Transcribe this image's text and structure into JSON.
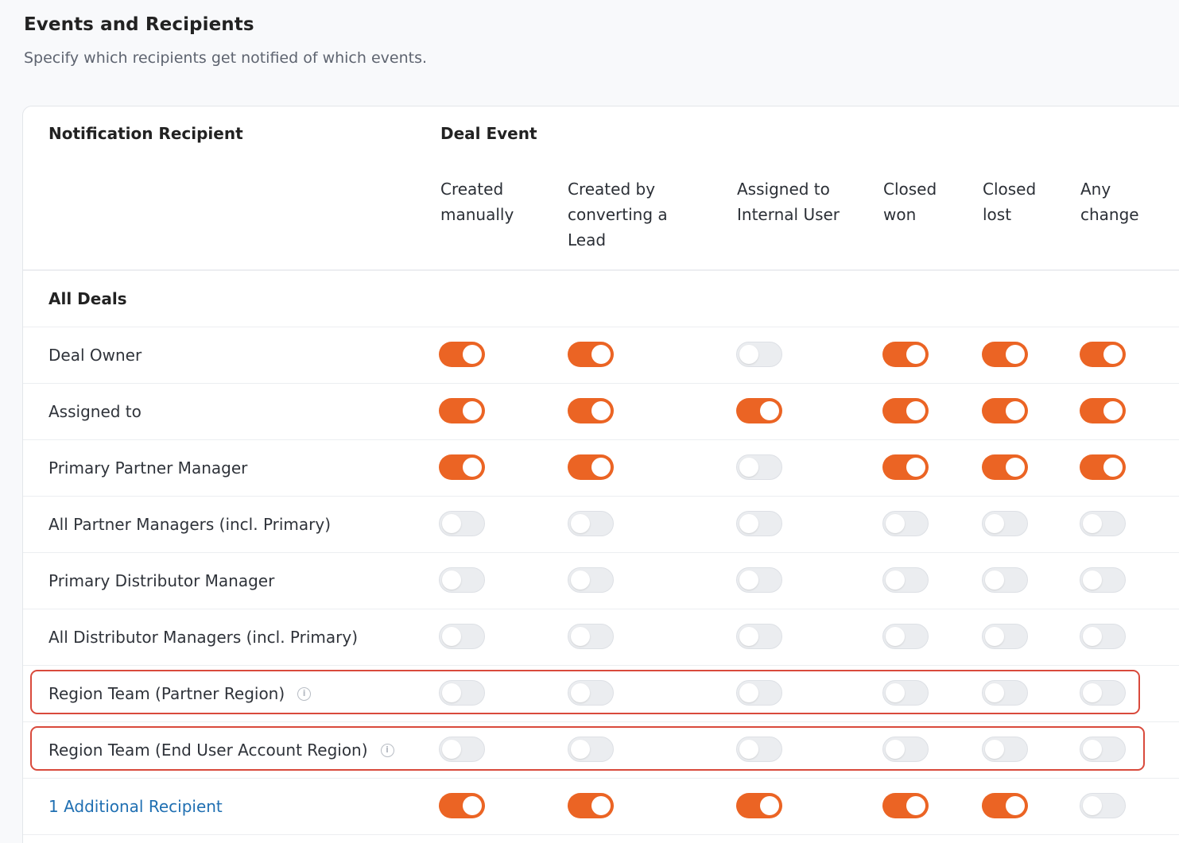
{
  "section": {
    "title": "Events and Recipients",
    "subtitle": "Specify which recipients get notified of which events."
  },
  "table": {
    "recipient_header": "Notification Recipient",
    "event_header": "Deal Event",
    "columns": [
      [
        "Created",
        "manually"
      ],
      [
        "Created by",
        "converting a",
        "Lead"
      ],
      [
        "Assigned to",
        "Internal User"
      ],
      [
        "Closed",
        "won"
      ],
      [
        "Closed",
        "lost"
      ],
      [
        "Any",
        "change"
      ]
    ],
    "group_label": "All Deals",
    "rows": [
      {
        "label": "Deal Owner",
        "toggles": [
          true,
          true,
          false,
          true,
          true,
          true
        ],
        "info": false
      },
      {
        "label": "Assigned to",
        "toggles": [
          true,
          true,
          true,
          true,
          true,
          true
        ],
        "info": false
      },
      {
        "label": "Primary Partner Manager",
        "toggles": [
          true,
          true,
          false,
          true,
          true,
          true
        ],
        "info": false
      },
      {
        "label": "All Partner Managers (incl. Primary)",
        "toggles": [
          false,
          false,
          false,
          false,
          false,
          false
        ],
        "info": false
      },
      {
        "label": "Primary Distributor Manager",
        "toggles": [
          false,
          false,
          false,
          false,
          false,
          false
        ],
        "info": false
      },
      {
        "label": "All Distributor Managers (incl. Primary)",
        "toggles": [
          false,
          false,
          false,
          false,
          false,
          false
        ],
        "info": false
      },
      {
        "label": "Region Team (Partner Region)",
        "toggles": [
          false,
          false,
          false,
          false,
          false,
          false
        ],
        "info": true,
        "highlighted": true
      },
      {
        "label": "Region Team (End User Account Region)",
        "toggles": [
          false,
          false,
          false,
          false,
          false,
          false
        ],
        "info": true,
        "highlighted": true
      },
      {
        "label": "1 Additional Recipient",
        "toggles": [
          true,
          true,
          true,
          true,
          true,
          false
        ],
        "info": false,
        "link": true
      }
    ]
  },
  "colors": {
    "toggle_on": "#eb6424",
    "toggle_off": "#ebedf0",
    "link": "#1f6fb2",
    "highlight_border": "#d94a3c"
  },
  "icons": {
    "info": "info-circle-icon"
  }
}
